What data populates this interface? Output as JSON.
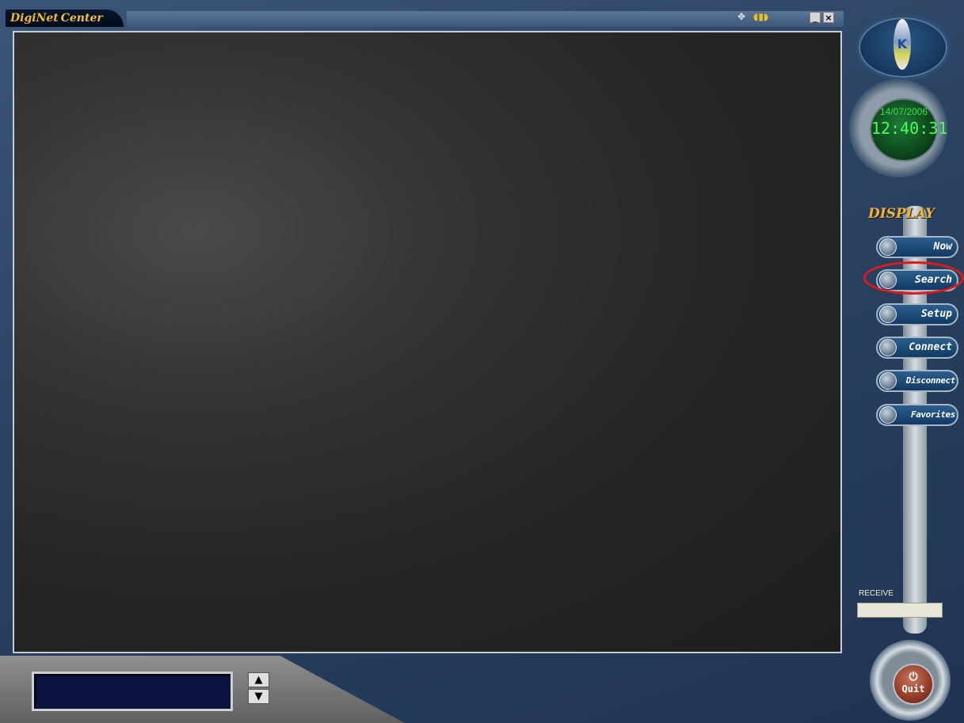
{
  "window": {
    "title_part1": "DigiNet",
    "title_part2": "Center",
    "icons": [
      "move-icon",
      "audio-icon"
    ],
    "minimize_label": "_",
    "close_label": "×"
  },
  "clock": {
    "date": "14/07/2006",
    "time": "12:40:31"
  },
  "display_menu": {
    "heading": "DISPLAY",
    "items": [
      {
        "label": "Now"
      },
      {
        "label": "Search"
      },
      {
        "label": "Setup"
      },
      {
        "label": "Connect"
      },
      {
        "label": "Disconnect"
      },
      {
        "label": "Favorites"
      }
    ]
  },
  "receive": {
    "label": "RECEIVE",
    "value": ""
  },
  "quit": {
    "label": "Quit",
    "icon": "power-icon"
  },
  "status": {
    "value": "",
    "up_label": "▲",
    "down_label": "▼"
  },
  "colors": {
    "title_text": "#f2b630",
    "clock_text": "#48ff5a",
    "display_heading": "#f2b23c",
    "highlight": "#e01a1a"
  }
}
